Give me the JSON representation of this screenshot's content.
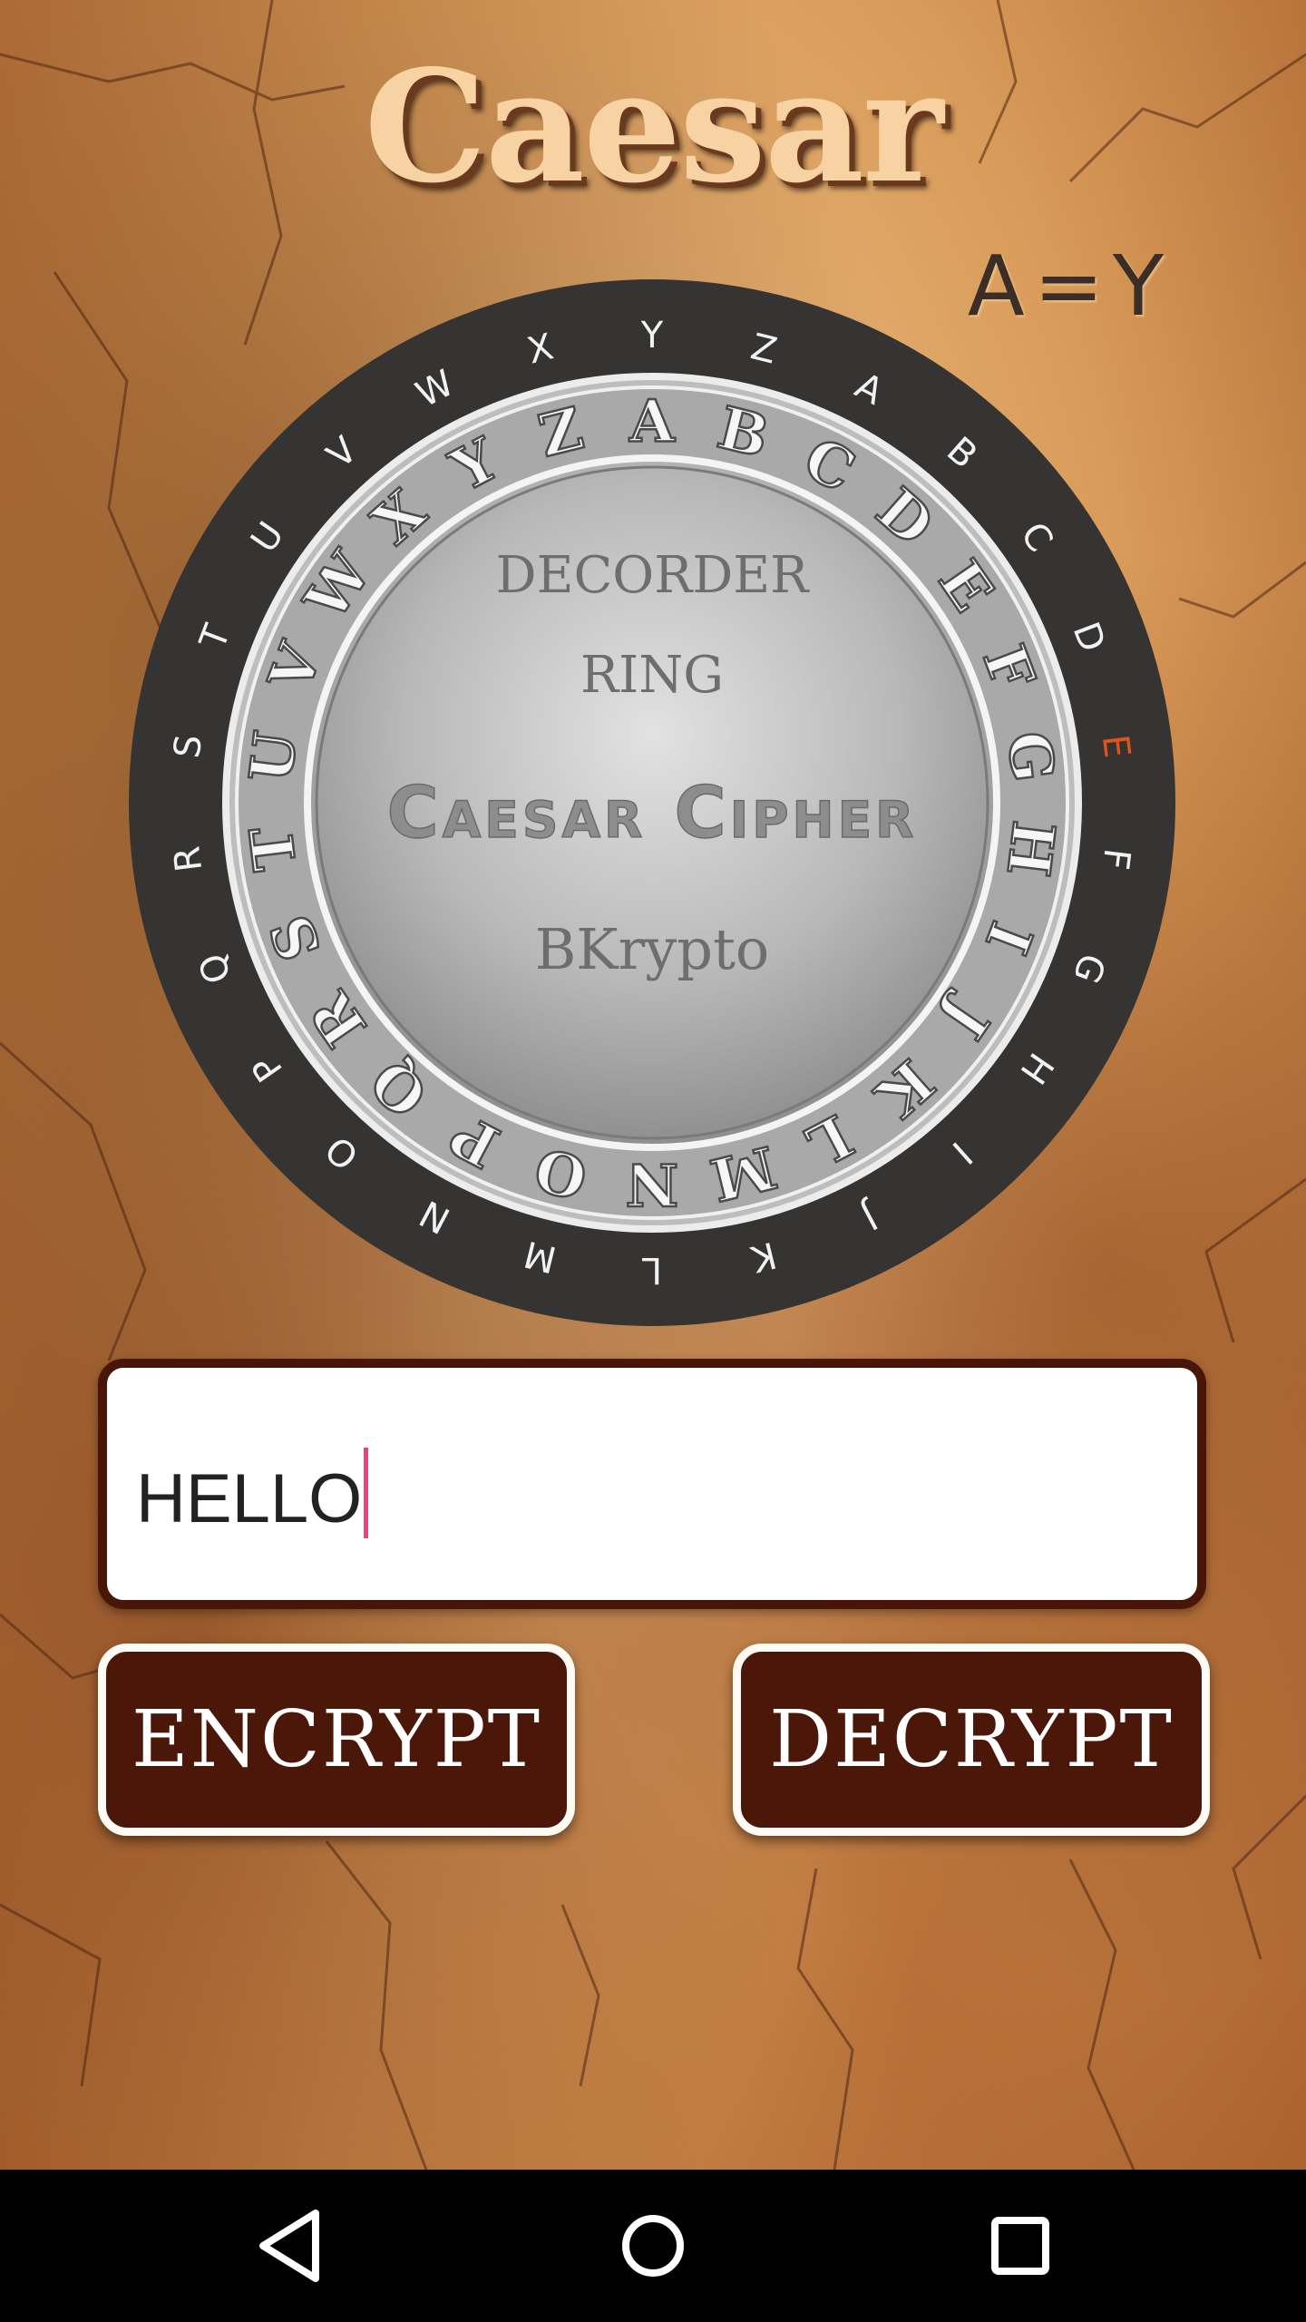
{
  "app": {
    "title": "Caesar"
  },
  "shift": {
    "plain": "A",
    "equals": "=",
    "cipher": "Y",
    "display": "A=Y"
  },
  "wheel": {
    "outer_letters": [
      "Y",
      "Z",
      "A",
      "B",
      "C",
      "D",
      "E",
      "F",
      "G",
      "H",
      "I",
      "J",
      "K",
      "L",
      "M",
      "N",
      "O",
      "P",
      "Q",
      "R",
      "S",
      "T",
      "U",
      "V",
      "W",
      "X"
    ],
    "outer_highlight_letter": "E",
    "outer_highlight_color": "#e0531c",
    "inner_letters": [
      "A",
      "B",
      "C",
      "D",
      "E",
      "F",
      "G",
      "H",
      "I",
      "J",
      "K",
      "L",
      "M",
      "N",
      "O",
      "P",
      "Q",
      "R",
      "S",
      "T",
      "U",
      "V",
      "W",
      "X",
      "Y",
      "Z"
    ],
    "center_line1": "DECORDER",
    "center_line2": "RING",
    "center_line3": "Caesar Cipher",
    "center_line4": "BKrypto"
  },
  "input": {
    "value": "HELLO"
  },
  "buttons": {
    "encrypt": "ENCRYPT",
    "decrypt": "DECRYPT"
  },
  "colors": {
    "button_bg": "#4a1709",
    "input_border": "#4a1509",
    "caret": "#e8457a",
    "title": "#f7d3a4"
  },
  "navbar": {
    "back_icon": "back-triangle-icon",
    "home_icon": "home-circle-icon",
    "recents_icon": "recents-square-icon"
  }
}
